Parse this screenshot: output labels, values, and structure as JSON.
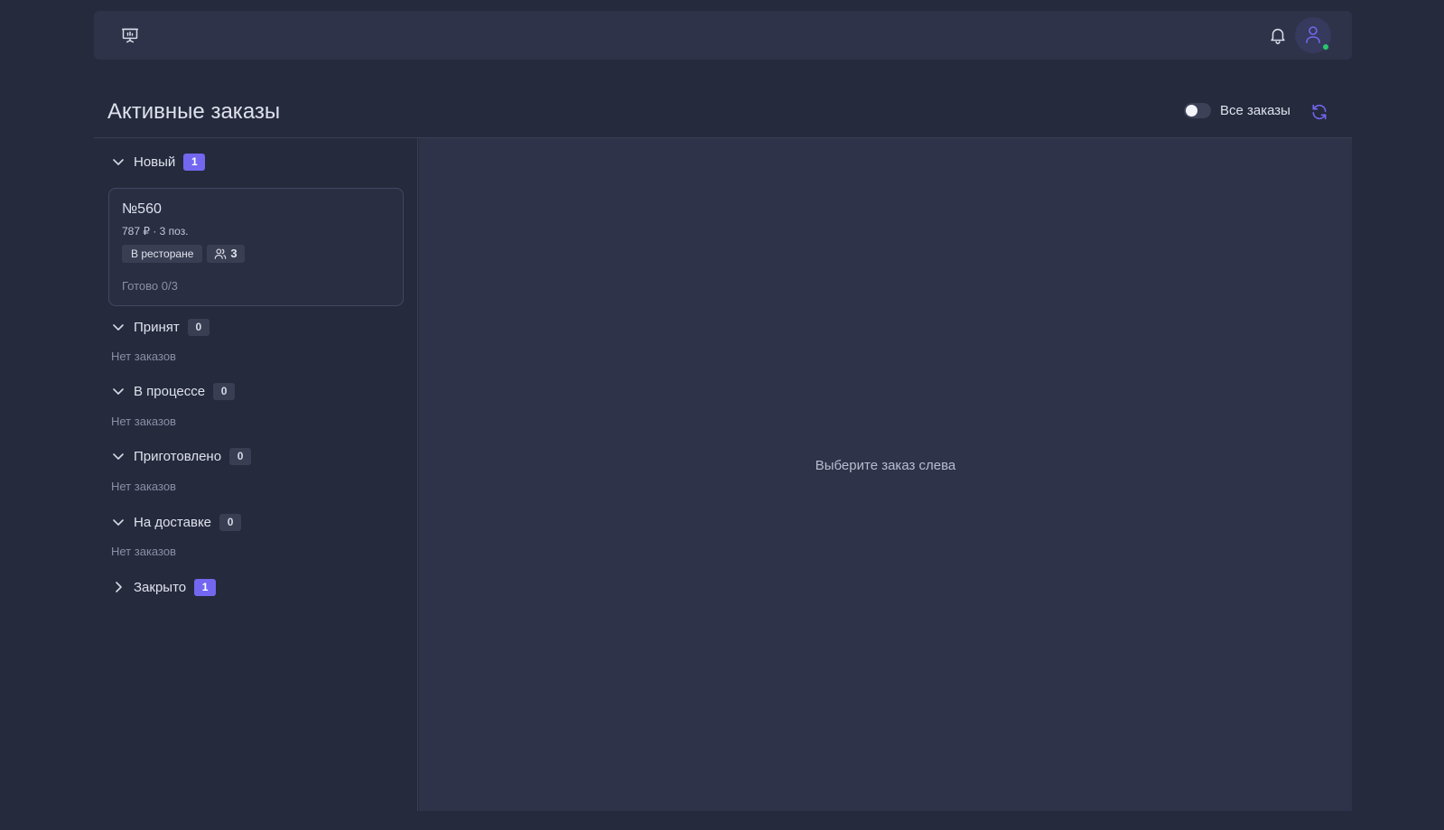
{
  "topbar": {
    "left_icon": "presentation-monitor-icon",
    "notification_icon": "bell-icon",
    "avatar_icon": "user-icon",
    "online_color": "#28c76f"
  },
  "page": {
    "title": "Активные заказы",
    "all_orders_label": "Все заказы",
    "all_orders_toggle_on": false,
    "refresh_icon": "refresh-icon"
  },
  "colors": {
    "accent": "#7367f0",
    "background": "#252a3d",
    "panel": "#2f3349"
  },
  "groups": [
    {
      "name": "Новый",
      "count": "1",
      "expanded": true,
      "orders": [
        {
          "number": "№560",
          "meta": "787 ₽ · 3 поз.",
          "location": "В ресторане",
          "guests": "3",
          "ready": "Готово 0/3"
        }
      ]
    },
    {
      "name": "Принят",
      "count": "0",
      "expanded": true,
      "empty": "Нет заказов"
    },
    {
      "name": "В процессе",
      "count": "0",
      "expanded": true,
      "empty": "Нет заказов"
    },
    {
      "name": "Приготовлено",
      "count": "0",
      "expanded": true,
      "empty": "Нет заказов"
    },
    {
      "name": "На доставке",
      "count": "0",
      "expanded": true,
      "empty": "Нет заказов"
    },
    {
      "name": "Закрыто",
      "count": "1",
      "expanded": false
    }
  ],
  "detail": {
    "placeholder": "Выберите заказ слева"
  }
}
